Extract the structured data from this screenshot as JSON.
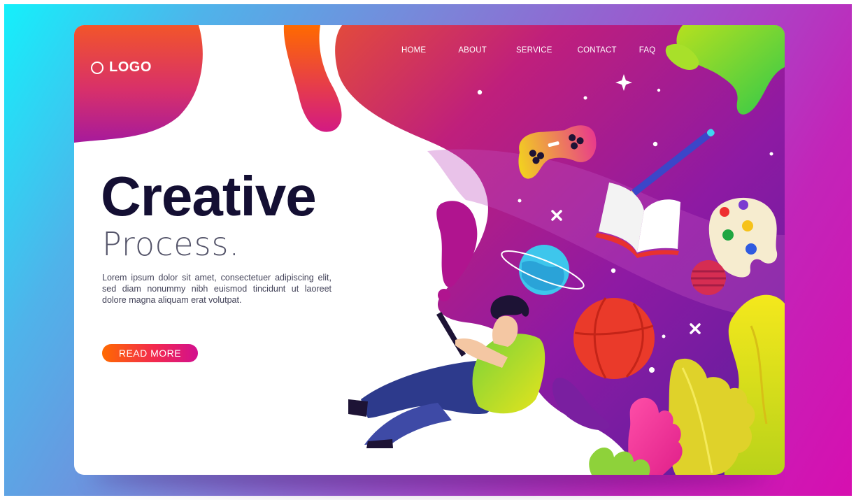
{
  "logo": {
    "text": "LOGO"
  },
  "nav": {
    "items": [
      {
        "label": "HOME"
      },
      {
        "label": "ABOUT"
      },
      {
        "label": "SERVICE"
      },
      {
        "label": "CONTACT"
      },
      {
        "label": "FAQ"
      }
    ]
  },
  "hero": {
    "title": "Creative",
    "subtitle": "Process.",
    "description": "Lorem ipsum dolor sit amet, consectetuer adipiscing elit, sed diam nonummy nibh euismod tincidunt ut laoreet dolore magna aliquam erat volutpat.",
    "cta_label": "READ MORE"
  },
  "colors": {
    "backdrop_start": "#14f0fb",
    "backdrop_end": "#d60fb0",
    "headline": "#140f33",
    "cta_start": "#ff6a00",
    "cta_end": "#d2108f",
    "accent_purple": "#8a1fa3",
    "accent_orange": "#f2552a"
  }
}
